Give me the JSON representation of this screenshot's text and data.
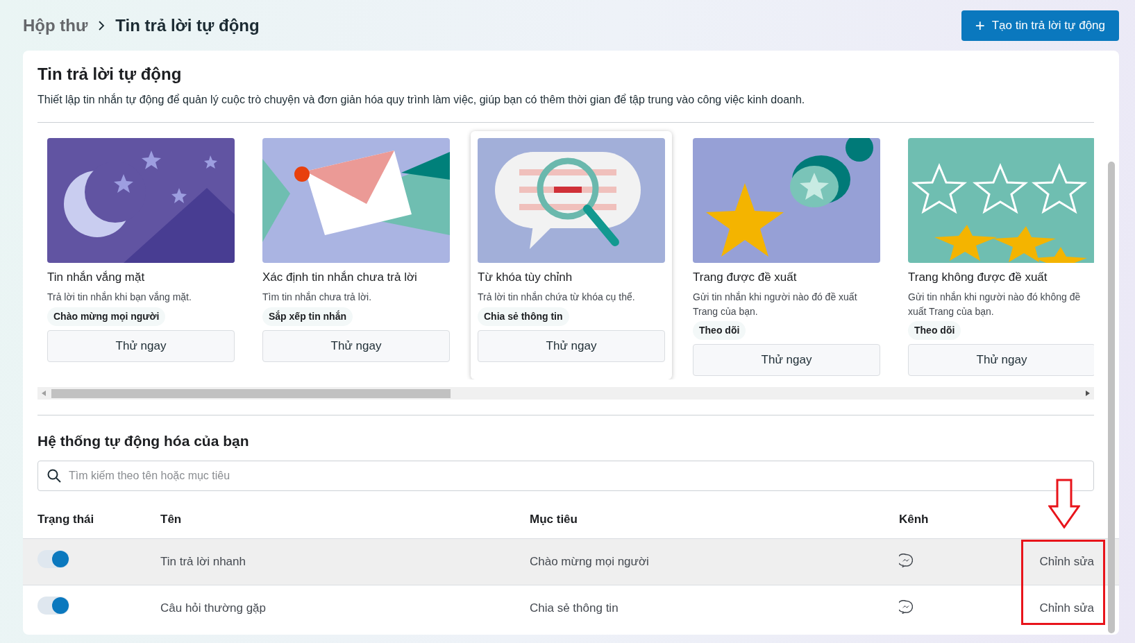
{
  "breadcrumb": [
    {
      "label": "Hộp thư"
    },
    {
      "label": "Tin trả lời tự động"
    }
  ],
  "create_button": {
    "icon": "+",
    "label": "Tạo tin trả lời tự động"
  },
  "intro": {
    "title": "Tin trả lời tự động",
    "description": "Thiết lập tin nhắn tự động để quản lý cuộc trò chuyện và đơn giản hóa quy trình làm việc, giúp bạn có thêm thời gian để tập trung vào công việc kinh doanh."
  },
  "templates": [
    {
      "kind": "moon",
      "title": "Tin nhắn vắng mặt",
      "description": "Trả lời tin nhắn khi bạn vắng mặt.",
      "tag": "Chào mừng mọi người",
      "button": "Thử ngay",
      "highlighted": false
    },
    {
      "kind": "envelope",
      "title": "Xác định tin nhắn chưa trả lời",
      "description": "Tìm tin nhắn chưa trả lời.",
      "tag": "Sắp xếp tin nhắn",
      "button": "Thử ngay",
      "highlighted": false
    },
    {
      "kind": "magnifier",
      "title": "Từ khóa tùy chỉnh",
      "description": "Trả lời tin nhắn chứa từ khóa cụ thể.",
      "tag": "Chia sẻ thông tin",
      "button": "Thử ngay",
      "highlighted": true
    },
    {
      "kind": "stamp",
      "title": "Trang được đề xuất",
      "description": "Gửi tin nhắn khi người nào đó đề xuất Trang của bạn.",
      "tag": "Theo dõi",
      "button": "Thử ngay",
      "highlighted": false
    },
    {
      "kind": "stars",
      "title": "Trang không được đề xuất",
      "description": "Gửi tin nhắn khi người nào đó không đề xuất Trang của bạn.",
      "tag": "Theo dõi",
      "button": "Thử ngay",
      "highlighted": false
    }
  ],
  "automations": {
    "title": "Hệ thống tự động hóa của bạn",
    "search": {
      "placeholder": "Tìm kiếm theo tên hoặc mục tiêu"
    },
    "columns": [
      "Trạng thái",
      "Tên",
      "Mục tiêu",
      "Kênh"
    ],
    "rows": [
      {
        "on": true,
        "name": "Tin trả lời nhanh",
        "goal": "Chào mừng mọi người",
        "action": "Chỉnh sửa",
        "highlighted": true
      },
      {
        "on": true,
        "name": "Câu hỏi thường gặp",
        "goal": "Chia sẻ thông tin",
        "action": "Chỉnh sửa",
        "highlighted": false
      }
    ]
  }
}
